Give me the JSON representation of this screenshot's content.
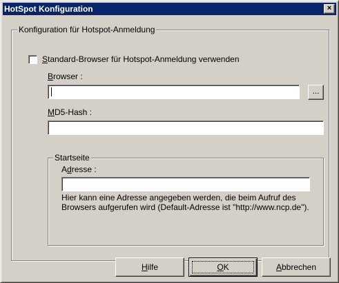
{
  "window": {
    "title": "HotSpot Konfiguration",
    "close_glyph": "×"
  },
  "group_main": {
    "title": "Konfiguration für Hotspot-Anmeldung"
  },
  "checkbox_default_browser": {
    "mnemonic": "S",
    "label_rest": "tandard-Browser für Hotspot-Anmeldung verwenden",
    "checked": false
  },
  "browser": {
    "label_mnemonic": "B",
    "label_rest": "rowser :",
    "value": "",
    "browse_label": "..."
  },
  "md5": {
    "label_mnemonic": "M",
    "label_rest": "D5-Hash :",
    "value": ""
  },
  "startseite": {
    "title": "Startseite",
    "address_label_pre": "A",
    "address_label_mnemonic": "d",
    "address_label_rest": "resse :",
    "address_value": "",
    "help_text": "Hier kann eine Adresse angegeben werden, die beim Aufruf des Browsers aufgerufen wird (Default-Adresse ist \"http://www.ncp.de\")."
  },
  "buttons": {
    "help_mnemonic": "H",
    "help_rest": "ilfe",
    "ok_mnemonic": "O",
    "ok_rest": "K",
    "cancel_mnemonic": "A",
    "cancel_rest": "bbrechen"
  },
  "colors": {
    "face": "#d4d0c8",
    "titlebar": "#0a246a",
    "field": "#ffffff"
  }
}
